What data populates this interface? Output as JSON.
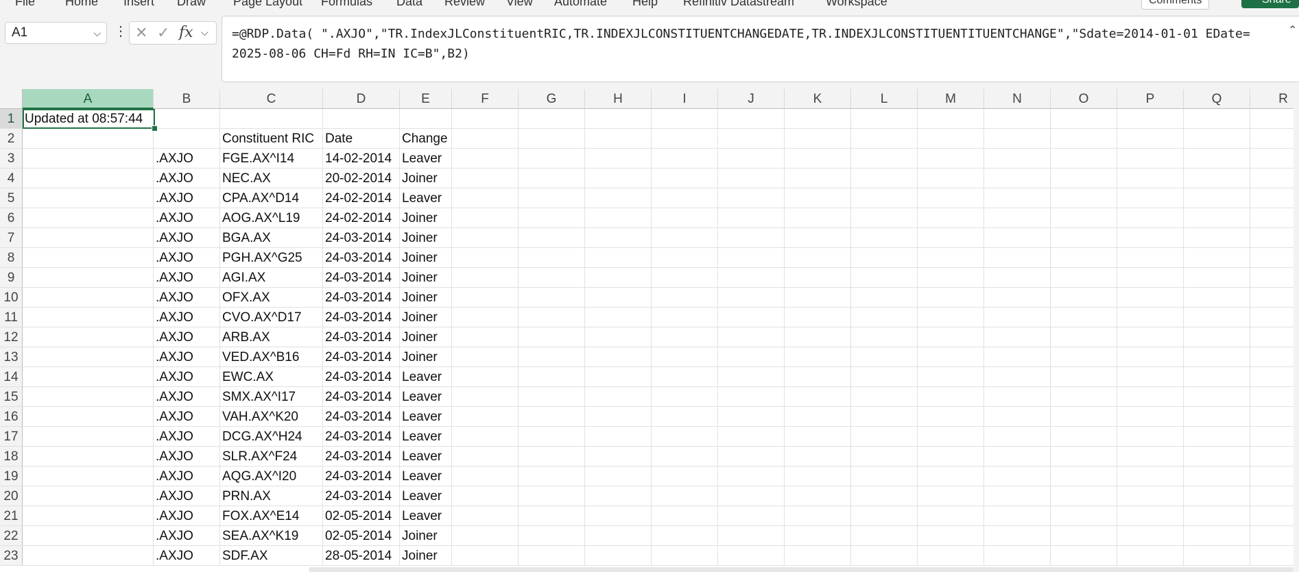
{
  "ribbon": {
    "tabs": [
      "File",
      "Home",
      "Insert",
      "Draw",
      "Page Layout",
      "Formulas",
      "Data",
      "Review",
      "View",
      "Automate",
      "Help",
      "Refinitiv Datastream",
      "Workspace"
    ],
    "comments_label": "Comments",
    "share_label": "Share"
  },
  "formula_bar": {
    "name_box": "A1",
    "formula": "=@RDP.Data( \".AXJO\",\"TR.IndexJLConstituentRIC,TR.INDEXJLCONSTITUENTCHANGEDATE,TR.INDEXJLCONSTITUENTITUENTCHANGE\",\"Sdate=2014-01-01 EDate=2025-08-06 CH=Fd RH=IN IC=B\",B2)"
  },
  "sheet": {
    "columns": [
      "A",
      "B",
      "C",
      "D",
      "E",
      "F",
      "G",
      "H",
      "I",
      "J",
      "K",
      "L",
      "M",
      "N",
      "O",
      "P",
      "Q",
      "R"
    ],
    "row_numbers": [
      "1",
      "2",
      "3",
      "4",
      "5",
      "6",
      "7",
      "8",
      "9",
      "10",
      "11",
      "12",
      "13",
      "14",
      "15",
      "16",
      "17",
      "18",
      "19",
      "20",
      "21",
      "22",
      "23"
    ],
    "rows": [
      [
        "Updated at 08:57:44",
        "",
        "",
        "",
        ""
      ],
      [
        "",
        "",
        "Constituent RIC",
        "Date",
        "Change"
      ],
      [
        "",
        ".AXJO",
        "FGE.AX^I14",
        "14-02-2014",
        "Leaver"
      ],
      [
        "",
        ".AXJO",
        "NEC.AX",
        "20-02-2014",
        "Joiner"
      ],
      [
        "",
        ".AXJO",
        "CPA.AX^D14",
        "24-02-2014",
        "Leaver"
      ],
      [
        "",
        ".AXJO",
        "AOG.AX^L19",
        "24-02-2014",
        "Joiner"
      ],
      [
        "",
        ".AXJO",
        "BGA.AX",
        "24-03-2014",
        "Joiner"
      ],
      [
        "",
        ".AXJO",
        "PGH.AX^G25",
        "24-03-2014",
        "Joiner"
      ],
      [
        "",
        ".AXJO",
        "AGI.AX",
        "24-03-2014",
        "Joiner"
      ],
      [
        "",
        ".AXJO",
        "OFX.AX",
        "24-03-2014",
        "Joiner"
      ],
      [
        "",
        ".AXJO",
        "CVO.AX^D17",
        "24-03-2014",
        "Joiner"
      ],
      [
        "",
        ".AXJO",
        "ARB.AX",
        "24-03-2014",
        "Joiner"
      ],
      [
        "",
        ".AXJO",
        "VED.AX^B16",
        "24-03-2014",
        "Joiner"
      ],
      [
        "",
        ".AXJO",
        "EWC.AX",
        "24-03-2014",
        "Leaver"
      ],
      [
        "",
        ".AXJO",
        "SMX.AX^I17",
        "24-03-2014",
        "Leaver"
      ],
      [
        "",
        ".AXJO",
        "VAH.AX^K20",
        "24-03-2014",
        "Leaver"
      ],
      [
        "",
        ".AXJO",
        "DCG.AX^H24",
        "24-03-2014",
        "Leaver"
      ],
      [
        "",
        ".AXJO",
        "SLR.AX^F24",
        "24-03-2014",
        "Leaver"
      ],
      [
        "",
        ".AXJO",
        "AQG.AX^I20",
        "24-03-2014",
        "Leaver"
      ],
      [
        "",
        ".AXJO",
        "PRN.AX",
        "24-03-2014",
        "Leaver"
      ],
      [
        "",
        ".AXJO",
        "FOX.AX^E14",
        "02-05-2014",
        "Leaver"
      ],
      [
        "",
        ".AXJO",
        "SEA.AX^K19",
        "02-05-2014",
        "Joiner"
      ],
      [
        "",
        ".AXJO",
        "SDF.AX",
        "28-05-2014",
        "Joiner"
      ]
    ]
  },
  "colors": {
    "accent": "#217346",
    "header_active": "#a8d9bf",
    "header_bg": "#f3f3f3",
    "gridline": "#e1e1e1"
  },
  "icons": {
    "cancel": "close-icon",
    "enter": "check-icon",
    "function": "fx-icon"
  }
}
